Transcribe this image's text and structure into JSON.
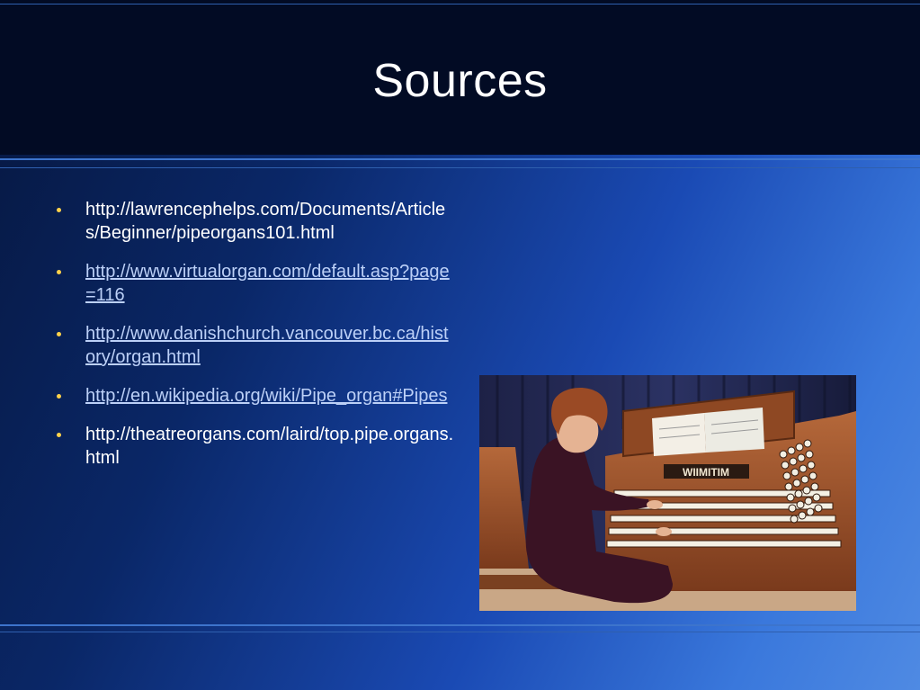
{
  "slide": {
    "title": "Sources",
    "sources": [
      {
        "text": "http://lawrencephelps.com/Documents/Articles/Beginner/pipeorgans101.html",
        "hyperlink": false
      },
      {
        "text": "http://www.virtualorgan.com/default.asp?page=116",
        "hyperlink": true
      },
      {
        "text": "http://www.danishchurch.vancouver.bc.ca/history/organ.html",
        "hyperlink": true
      },
      {
        "text": "http://en.wikipedia.org/wiki/Pipe_organ#Pipes",
        "hyperlink": true
      },
      {
        "text": "http://theatreorgans.com/laird/top.pipe.organs.html",
        "hyperlink": false
      }
    ],
    "image": {
      "subject": "woman-playing-pipe-organ-console",
      "console_nameplate": "WIIMITIM"
    }
  },
  "colors": {
    "header_bg": "#020b24",
    "accent_line": "#3d74cc",
    "bullet": "#ffd24a",
    "link": "#bcd0f7",
    "text": "#ffffff"
  }
}
